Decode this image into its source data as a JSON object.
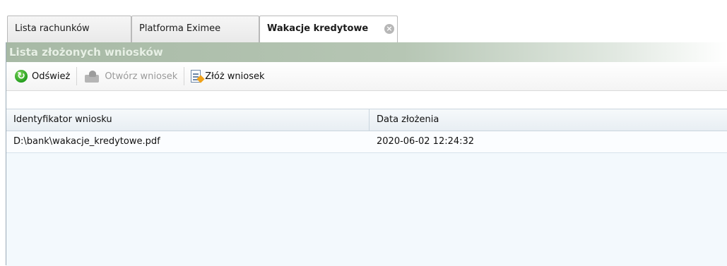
{
  "tabs": [
    {
      "label": "Lista rachunków",
      "active": false
    },
    {
      "label": "Platforma Eximee",
      "active": false
    },
    {
      "label": "Wakacje kredytowe",
      "active": true
    }
  ],
  "panel": {
    "title": "Lista złożonych wniosków"
  },
  "toolbar": {
    "refresh_label": "Odśwież",
    "open_label": "Otwórz wniosek",
    "submit_label": "Złóż wniosek"
  },
  "grid": {
    "columns": [
      "Identyfikator wniosku",
      "Data złożenia"
    ],
    "rows": [
      [
        "D:\\bank\\wakacje_kredytowe.pdf",
        "2020-06-02 12:24:32"
      ]
    ]
  },
  "icons": {
    "refresh": "refresh-icon",
    "open": "open-request-icon",
    "submit": "submit-request-icon",
    "close": "close-icon"
  },
  "colors": {
    "header_green": "#a7b9a5",
    "grid_background": "#f3f9fd",
    "refresh_green": "#239d1d"
  }
}
